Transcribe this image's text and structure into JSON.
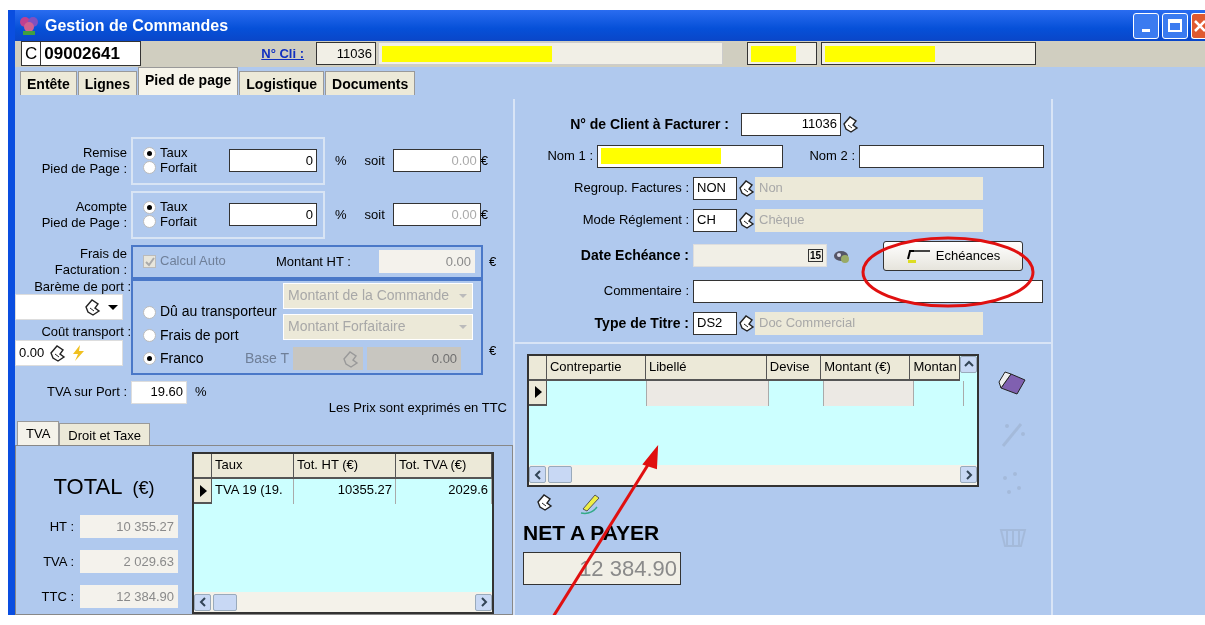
{
  "window": {
    "title": "Gestion de Commandes"
  },
  "header": {
    "doc_prefix": "C",
    "doc_number": "09002641",
    "client_link": "N° Cli :",
    "client_number": "11036",
    "client_name": {
      "redacted": true
    },
    "extra_fields": [
      {
        "redacted": true
      },
      {
        "redacted": true
      }
    ]
  },
  "tabs": [
    {
      "label": "Entête",
      "selected": false
    },
    {
      "label": "Lignes",
      "selected": false
    },
    {
      "label": "Pied de page",
      "selected": true
    },
    {
      "label": "Logistique",
      "selected": false
    },
    {
      "label": "Documents",
      "selected": false
    }
  ],
  "discounts": [
    {
      "label": "Remise\nPied de Page :",
      "options": [
        {
          "label": "Taux",
          "selected": true
        },
        {
          "label": "Forfait",
          "selected": false
        }
      ],
      "value": "0",
      "unit": "%",
      "soit": "soit",
      "amount": "0.00",
      "currency": "€"
    },
    {
      "label": "Acompte\nPied de Page :",
      "options": [
        {
          "label": "Taux",
          "selected": true
        },
        {
          "label": "Forfait",
          "selected": false
        }
      ],
      "value": "0",
      "unit": "%",
      "soit": "soit",
      "amount": "0.00",
      "currency": "€"
    }
  ],
  "billing_fee": {
    "label": "Frais de\nFacturation :",
    "auto": {
      "label": "Calcul Auto",
      "checked": true,
      "disabled": true
    },
    "amount_label": "Montant HT :",
    "amount": "0.00",
    "currency": "€"
  },
  "shipping": {
    "scale_label": "Barème de port :",
    "cost_label": "Coût transport :",
    "cost": "0.00",
    "options": [
      {
        "label": "Dû au transporteur",
        "selected": false
      },
      {
        "label": "Frais de port",
        "selected": false
      },
      {
        "label": "Franco",
        "selected": true
      }
    ],
    "selects": [
      {
        "value": "Montant de la Commande",
        "disabled": true
      },
      {
        "value": "Montant Forfaitaire",
        "disabled": true
      }
    ],
    "base_label": "Base T",
    "base_amount": "0.00",
    "currency": "€"
  },
  "vat_shipping": {
    "label": "TVA sur Port :",
    "value": "19.60",
    "unit": "%"
  },
  "price_note": "Les Prix sont exprimés en TTC",
  "sub_tabs": [
    {
      "label": "TVA",
      "selected": true
    },
    {
      "label": "Droit et Taxe",
      "selected": false
    }
  ],
  "totals": {
    "title": "TOTAL",
    "unit": "(€)",
    "rows": [
      {
        "label": "HT :",
        "value": "10 355.27"
      },
      {
        "label": "TVA :",
        "value": "2 029.63"
      },
      {
        "label": "TTC :",
        "value": "12 384.90"
      }
    ]
  },
  "vat_table": {
    "columns": [
      "Taux",
      "Tot. HT (€)",
      "Tot. TVA (€)"
    ],
    "rows": [
      [
        "TVA 19 (19.",
        "10355.27",
        "2029.6"
      ]
    ]
  },
  "billing": {
    "client_label": "N° de Client à Facturer :",
    "client_number": "11036",
    "name1": {
      "label": "Nom 1 :",
      "redacted": true
    },
    "name2": {
      "label": "Nom 2 :"
    },
    "grouping": {
      "label": "Regroup. Factures :",
      "code": "NON",
      "description": "Non"
    },
    "payment": {
      "label": "Mode Réglement :",
      "code": "CH",
      "description": "Chèque"
    },
    "due_date": {
      "label": "Date Echéance :",
      "calendar": "15"
    },
    "schedule_button": "Echéances",
    "comment": {
      "label": "Commentaire :"
    },
    "title_type": {
      "label": "Type de Titre :",
      "code": "DS2",
      "description": "Doc Commercial"
    }
  },
  "schedule_table": {
    "columns": [
      "Contrepartie",
      "Libellé",
      "Devise",
      "Montant (€)",
      "Montan"
    ]
  },
  "side_tools": [
    {
      "kind": "eraser",
      "disabled": false
    },
    {
      "kind": "wand",
      "disabled": true
    },
    {
      "kind": "sparkle",
      "disabled": true
    },
    {
      "kind": "basket",
      "disabled": true
    }
  ],
  "net": {
    "label": "NET A PAYER",
    "value": "12 384.90"
  },
  "annotations": {
    "ellipse": true,
    "arrow": true
  }
}
